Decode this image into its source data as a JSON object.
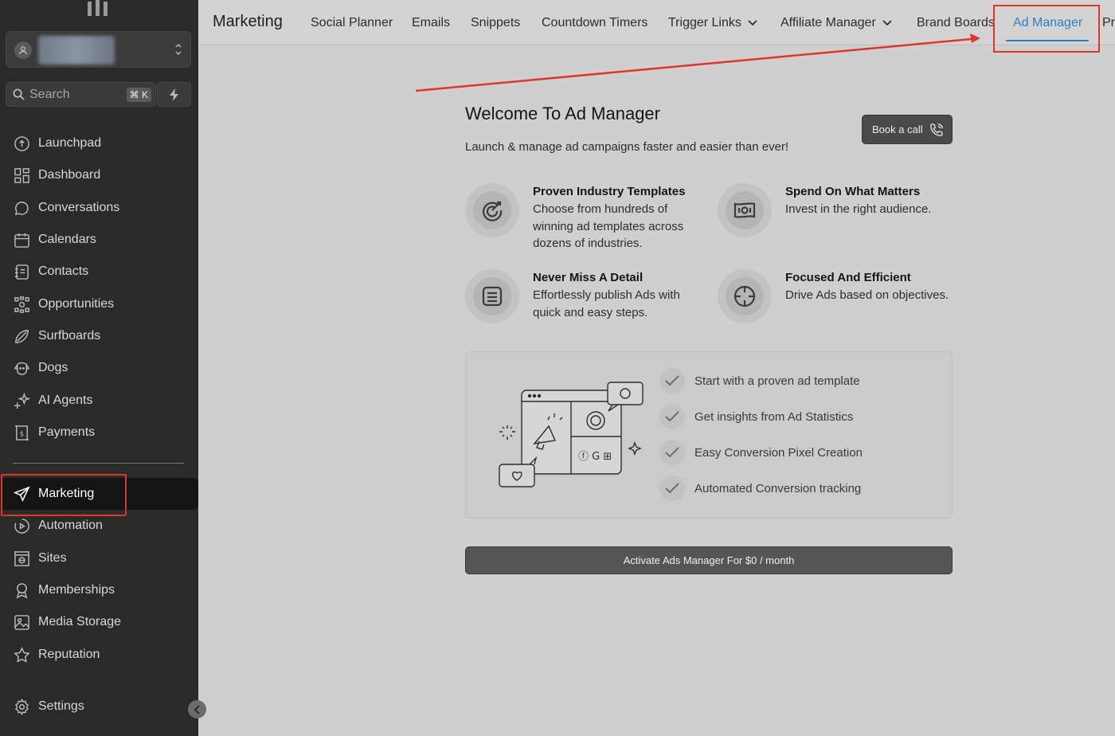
{
  "sidebar": {
    "search_placeholder": "Search",
    "search_shortcut": "⌘ K",
    "items": [
      {
        "label": "Launchpad",
        "icon": "launchpad-icon"
      },
      {
        "label": "Dashboard",
        "icon": "dashboard-icon"
      },
      {
        "label": "Conversations",
        "icon": "chat-icon"
      },
      {
        "label": "Calendars",
        "icon": "calendar-icon"
      },
      {
        "label": "Contacts",
        "icon": "contacts-icon"
      },
      {
        "label": "Opportunities",
        "icon": "opportunities-icon"
      },
      {
        "label": "Surfboards",
        "icon": "surfboard-icon"
      },
      {
        "label": "Dogs",
        "icon": "dog-icon"
      },
      {
        "label": "AI Agents",
        "icon": "sparkle-icon"
      },
      {
        "label": "Payments",
        "icon": "payments-icon"
      }
    ],
    "secondary_items": [
      {
        "label": "Marketing",
        "icon": "send-icon",
        "active": true
      },
      {
        "label": "Automation",
        "icon": "automation-icon"
      },
      {
        "label": "Sites",
        "icon": "sites-icon"
      },
      {
        "label": "Memberships",
        "icon": "badge-icon"
      },
      {
        "label": "Media Storage",
        "icon": "image-icon"
      },
      {
        "label": "Reputation",
        "icon": "star-icon"
      }
    ],
    "settings_label": "Settings"
  },
  "topbar": {
    "title": "Marketing",
    "tabs": [
      {
        "label": "Social Planner"
      },
      {
        "label": "Emails"
      },
      {
        "label": "Snippets"
      },
      {
        "label": "Countdown Timers"
      },
      {
        "label": "Trigger Links",
        "dropdown": true
      },
      {
        "label": "Affiliate Manager",
        "dropdown": true
      },
      {
        "label": "Brand Boards"
      },
      {
        "label": "Ad Manager",
        "active": true
      },
      {
        "label": "Pr"
      }
    ]
  },
  "main": {
    "title": "Welcome To Ad Manager",
    "subtitle": "Launch & manage ad campaigns faster and easier than ever!",
    "book_call_label": "Book a call",
    "features": [
      {
        "title": "Proven Industry Templates",
        "desc": "Choose from hundreds of winning ad templates across dozens of industries.",
        "icon": "target-icon"
      },
      {
        "title": "Spend On What Matters",
        "desc": "Invest in the right audience.",
        "icon": "money-icon"
      },
      {
        "title": "Never Miss A Detail",
        "desc": "Effortlessly publish Ads with quick and easy steps.",
        "icon": "list-icon"
      },
      {
        "title": "Focused And Efficient",
        "desc": "Drive Ads based on objectives.",
        "icon": "crosshair-icon"
      }
    ],
    "checklist": [
      "Start with a proven ad template",
      "Get insights from Ad Statistics",
      "Easy Conversion Pixel Creation",
      "Automated Conversion tracking"
    ],
    "activate_label": "Activate Ads Manager For $0 / month"
  },
  "colors": {
    "accent": "#2b7fc7",
    "highlight": "#e0352b",
    "sidebar_bg": "#2a2a2a"
  }
}
